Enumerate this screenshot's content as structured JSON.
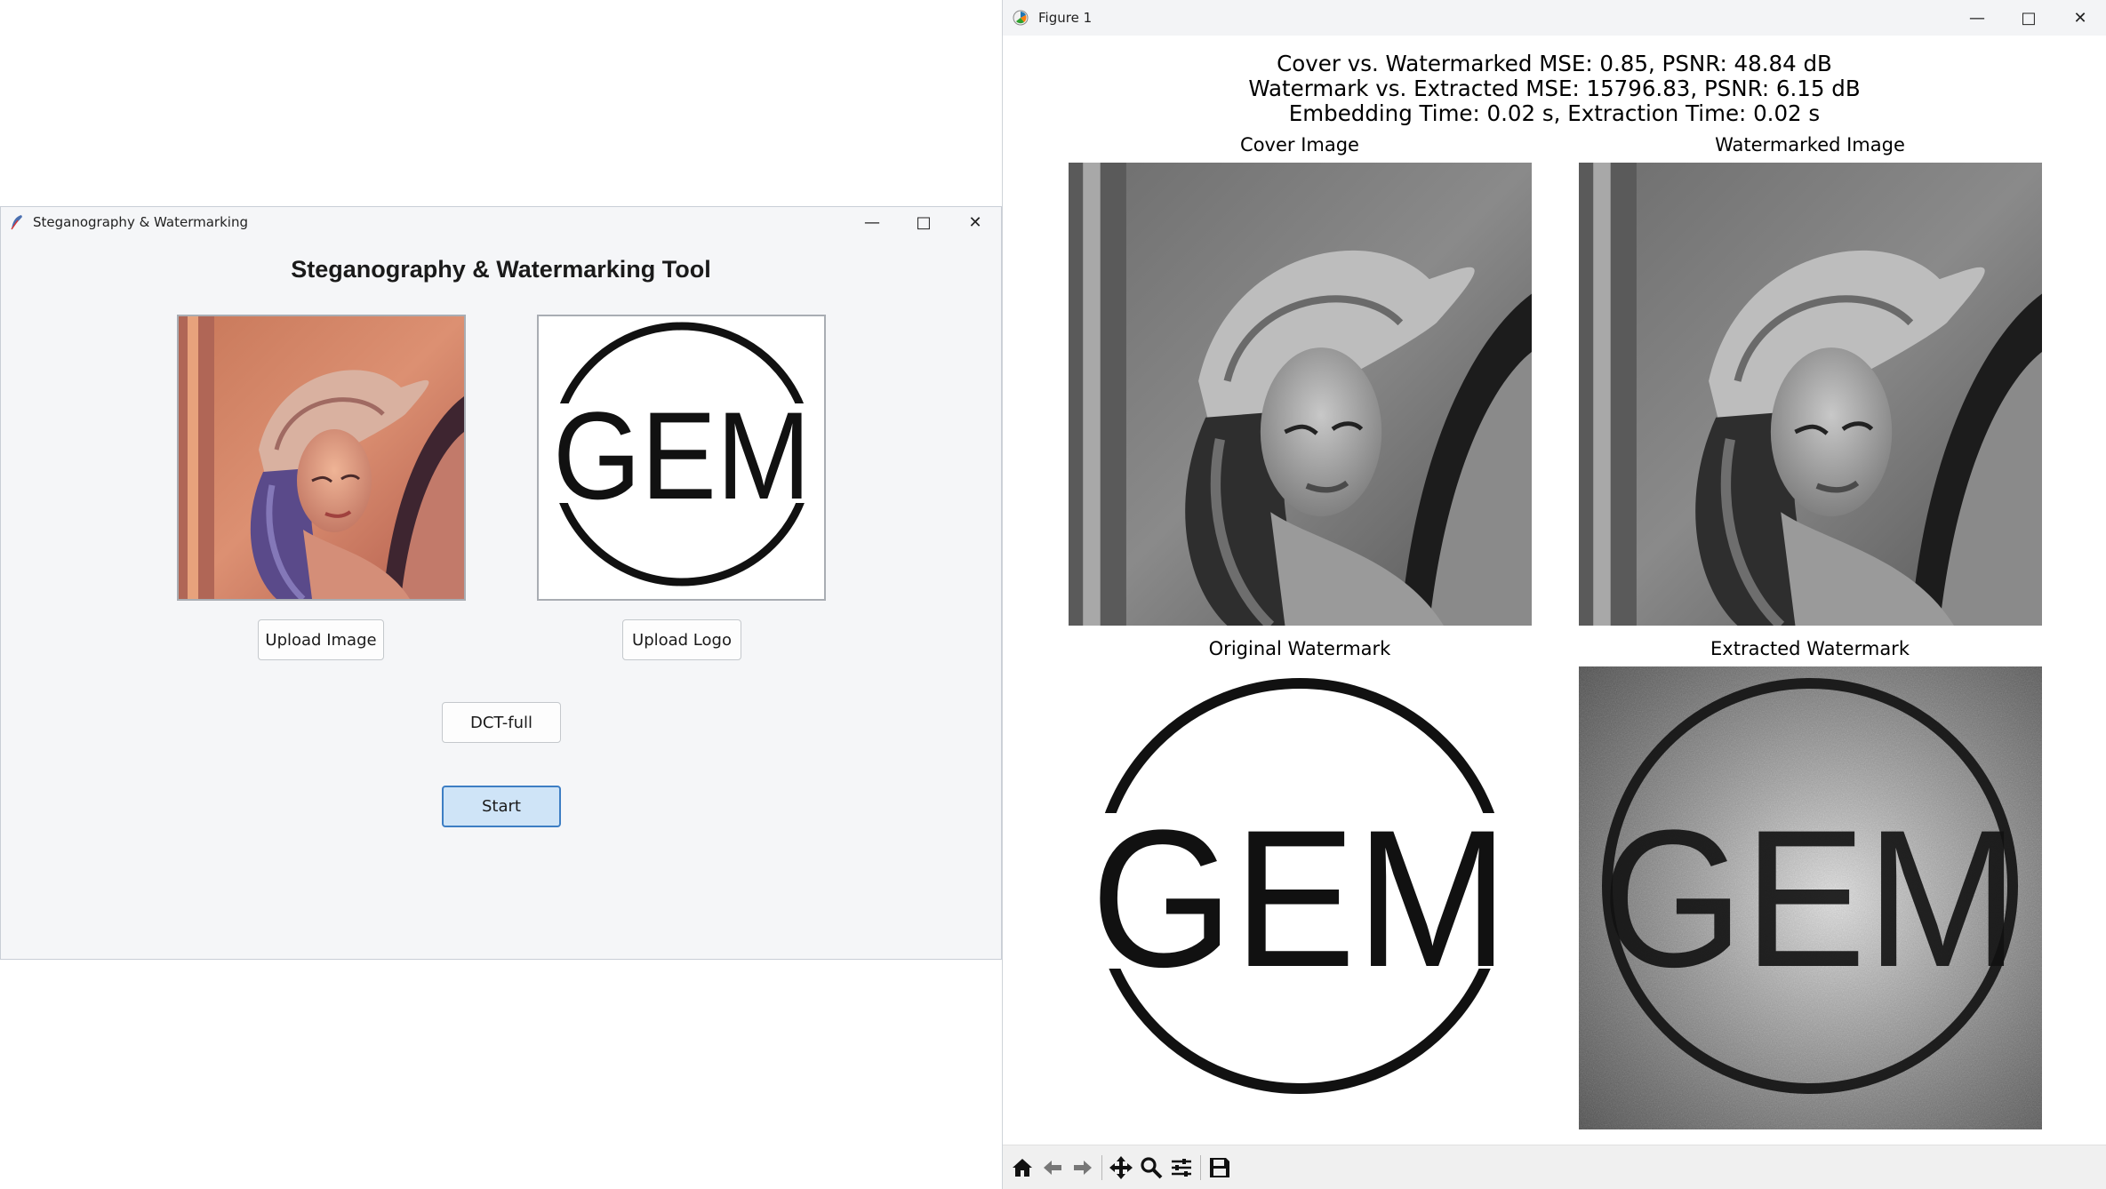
{
  "tk_window": {
    "title": "Steganography & Watermarking",
    "heading": "Steganography & Watermarking Tool",
    "controls": {
      "minimize": "—",
      "maximize": "□",
      "close": "✕"
    },
    "cover_preview": {
      "description": "Lena photograph (color)"
    },
    "logo_preview": {
      "text": "GEM"
    },
    "upload_image_label": "Upload Image",
    "upload_logo_label": "Upload Logo",
    "method_label": "DCT-full",
    "start_label": "Start"
  },
  "figure_window": {
    "title": "Figure 1",
    "controls": {
      "minimize": "—",
      "maximize": "□",
      "close": "✕"
    },
    "suptitle_lines": [
      "Cover vs. Watermarked MSE: 0.85, PSNR: 48.84 dB",
      "Watermark vs. Extracted MSE: 15796.83, PSNR: 6.15 dB",
      "Embedding Time: 0.02 s, Extraction Time: 0.02 s"
    ],
    "subplots": [
      {
        "title": "Cover Image"
      },
      {
        "title": "Watermarked Image"
      },
      {
        "title": "Original Watermark",
        "text": "GEM"
      },
      {
        "title": "Extracted Watermark",
        "text": "GEM"
      }
    ],
    "toolbar": [
      "home-icon",
      "back-icon",
      "forward-icon",
      "pan-icon",
      "zoom-icon",
      "configure-subplots-icon",
      "save-icon"
    ]
  },
  "colors": {
    "tk_background": "#f5f6f8",
    "start_button_fill": "#cfe4f7",
    "start_button_border": "#3d7ec4",
    "figure_background": "#ffffff"
  }
}
